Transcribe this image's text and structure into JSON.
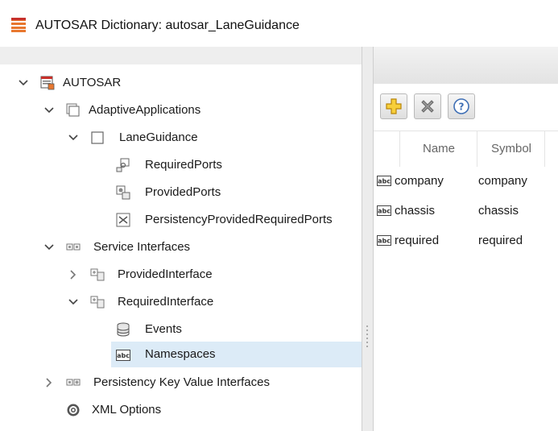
{
  "window": {
    "title": "AUTOSAR Dictionary: autosar_LaneGuidance"
  },
  "tree": {
    "root": "AUTOSAR",
    "adaptive_applications": "AdaptiveApplications",
    "lane_guidance": "LaneGuidance",
    "required_ports": "RequiredPorts",
    "provided_ports": "ProvidedPorts",
    "persistency_ports": "PersistencyProvidedRequiredPorts",
    "service_interfaces": "Service Interfaces",
    "provided_interface": "ProvidedInterface",
    "required_interface": "RequiredInterface",
    "events": "Events",
    "namespaces": "Namespaces",
    "persistency_kv_interfaces": "Persistency Key Value Interfaces",
    "xml_options": "XML Options"
  },
  "toolbar": {
    "add": "add-icon",
    "delete": "delete-icon",
    "help": "help-icon"
  },
  "table": {
    "columns": [
      "Name",
      "Symbol"
    ],
    "rows": [
      {
        "name": "company",
        "symbol": "company"
      },
      {
        "name": "chassis",
        "symbol": "chassis"
      },
      {
        "name": "required",
        "symbol": "required"
      }
    ]
  },
  "colors": {
    "selection": "#dcebf7",
    "title_icon_orange": "#e8772e",
    "add_icon_yellow": "#f7cf3a"
  }
}
